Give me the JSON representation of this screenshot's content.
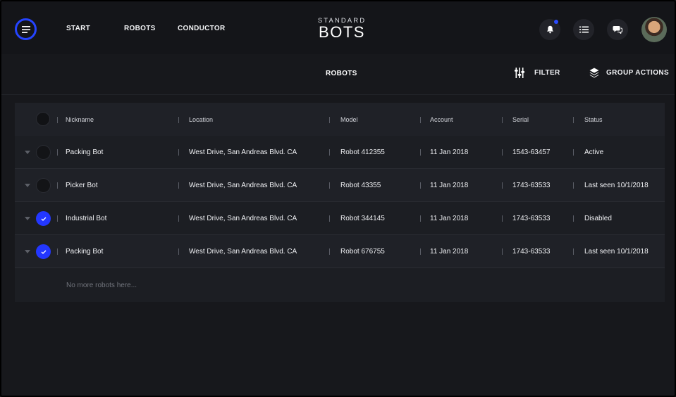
{
  "nav": {
    "links": [
      "START",
      "ROBOTS",
      "CONDUCTOR"
    ]
  },
  "logo": {
    "top": "STANDARD",
    "main": "BOTS"
  },
  "colors": {
    "accent": "#2544ff",
    "background": "#17181c"
  },
  "icons": {
    "menu": "hamburger-icon",
    "bell": "bell-icon",
    "list": "list-icon",
    "chat": "chat-bubbles-icon",
    "filter": "sliders-icon",
    "group": "layers-icon"
  },
  "subheader": {
    "title": "ROBOTS",
    "filter_label": "FILTER",
    "group_label": "GROUP ACTIONS"
  },
  "table": {
    "columns": [
      "Nickname",
      "Location",
      "Model",
      "Account",
      "Serial",
      "Status"
    ],
    "rows": [
      {
        "checked": false,
        "nickname": "Packing Bot",
        "location": "West Drive, San Andreas Blvd. CA",
        "model": "Robot 412355",
        "account": "11 Jan 2018",
        "serial": "1543-63457",
        "status": "Active"
      },
      {
        "checked": false,
        "nickname": "Picker Bot",
        "location": "West Drive, San Andreas Blvd. CA",
        "model": "Robot 43355",
        "account": "11 Jan 2018",
        "serial": "1743-63533",
        "status": "Last seen 10/1/2018"
      },
      {
        "checked": true,
        "nickname": "Industrial Bot",
        "location": "West Drive, San Andreas Blvd. CA",
        "model": "Robot 344145",
        "account": "11 Jan 2018",
        "serial": "1743-63533",
        "status": "Disabled"
      },
      {
        "checked": true,
        "nickname": "Packing Bot",
        "location": "West Drive, San Andreas Blvd. CA",
        "model": "Robot 676755",
        "account": "11 Jan 2018",
        "serial": "1743-63533",
        "status": "Last seen 10/1/2018"
      }
    ],
    "empty_note": "No more robots here..."
  }
}
